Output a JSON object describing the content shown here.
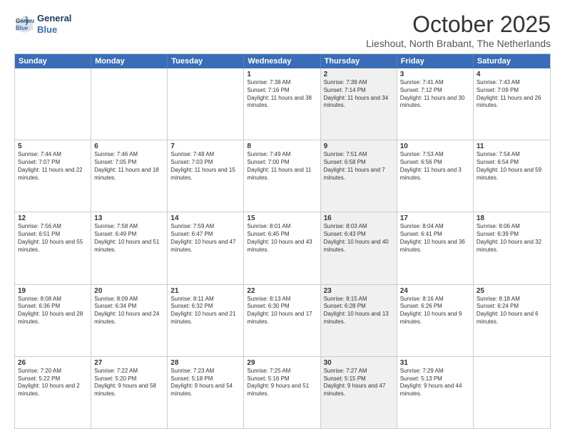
{
  "logo": {
    "line1": "General",
    "line2": "Blue"
  },
  "title": "October 2025",
  "subtitle": "Lieshout, North Brabant, The Netherlands",
  "header_days": [
    "Sunday",
    "Monday",
    "Tuesday",
    "Wednesday",
    "Thursday",
    "Friday",
    "Saturday"
  ],
  "rows": [
    [
      {
        "day": "",
        "text": "",
        "shaded": false,
        "empty": true
      },
      {
        "day": "",
        "text": "",
        "shaded": false,
        "empty": true
      },
      {
        "day": "",
        "text": "",
        "shaded": false,
        "empty": true
      },
      {
        "day": "1",
        "text": "Sunrise: 7:38 AM\nSunset: 7:16 PM\nDaylight: 11 hours and 38 minutes.",
        "shaded": false
      },
      {
        "day": "2",
        "text": "Sunrise: 7:39 AM\nSunset: 7:14 PM\nDaylight: 11 hours and 34 minutes.",
        "shaded": true
      },
      {
        "day": "3",
        "text": "Sunrise: 7:41 AM\nSunset: 7:12 PM\nDaylight: 11 hours and 30 minutes.",
        "shaded": false
      },
      {
        "day": "4",
        "text": "Sunrise: 7:43 AM\nSunset: 7:09 PM\nDaylight: 11 hours and 26 minutes.",
        "shaded": false
      }
    ],
    [
      {
        "day": "5",
        "text": "Sunrise: 7:44 AM\nSunset: 7:07 PM\nDaylight: 11 hours and 22 minutes.",
        "shaded": false
      },
      {
        "day": "6",
        "text": "Sunrise: 7:46 AM\nSunset: 7:05 PM\nDaylight: 11 hours and 18 minutes.",
        "shaded": false
      },
      {
        "day": "7",
        "text": "Sunrise: 7:48 AM\nSunset: 7:03 PM\nDaylight: 11 hours and 15 minutes.",
        "shaded": false
      },
      {
        "day": "8",
        "text": "Sunrise: 7:49 AM\nSunset: 7:00 PM\nDaylight: 11 hours and 11 minutes.",
        "shaded": false
      },
      {
        "day": "9",
        "text": "Sunrise: 7:51 AM\nSunset: 6:58 PM\nDaylight: 11 hours and 7 minutes.",
        "shaded": true
      },
      {
        "day": "10",
        "text": "Sunrise: 7:53 AM\nSunset: 6:56 PM\nDaylight: 11 hours and 3 minutes.",
        "shaded": false
      },
      {
        "day": "11",
        "text": "Sunrise: 7:54 AM\nSunset: 6:54 PM\nDaylight: 10 hours and 59 minutes.",
        "shaded": false
      }
    ],
    [
      {
        "day": "12",
        "text": "Sunrise: 7:56 AM\nSunset: 6:51 PM\nDaylight: 10 hours and 55 minutes.",
        "shaded": false
      },
      {
        "day": "13",
        "text": "Sunrise: 7:58 AM\nSunset: 6:49 PM\nDaylight: 10 hours and 51 minutes.",
        "shaded": false
      },
      {
        "day": "14",
        "text": "Sunrise: 7:59 AM\nSunset: 6:47 PM\nDaylight: 10 hours and 47 minutes.",
        "shaded": false
      },
      {
        "day": "15",
        "text": "Sunrise: 8:01 AM\nSunset: 6:45 PM\nDaylight: 10 hours and 43 minutes.",
        "shaded": false
      },
      {
        "day": "16",
        "text": "Sunrise: 8:03 AM\nSunset: 6:43 PM\nDaylight: 10 hours and 40 minutes.",
        "shaded": true
      },
      {
        "day": "17",
        "text": "Sunrise: 8:04 AM\nSunset: 6:41 PM\nDaylight: 10 hours and 36 minutes.",
        "shaded": false
      },
      {
        "day": "18",
        "text": "Sunrise: 8:06 AM\nSunset: 6:39 PM\nDaylight: 10 hours and 32 minutes.",
        "shaded": false
      }
    ],
    [
      {
        "day": "19",
        "text": "Sunrise: 8:08 AM\nSunset: 6:36 PM\nDaylight: 10 hours and 28 minutes.",
        "shaded": false
      },
      {
        "day": "20",
        "text": "Sunrise: 8:09 AM\nSunset: 6:34 PM\nDaylight: 10 hours and 24 minutes.",
        "shaded": false
      },
      {
        "day": "21",
        "text": "Sunrise: 8:11 AM\nSunset: 6:32 PM\nDaylight: 10 hours and 21 minutes.",
        "shaded": false
      },
      {
        "day": "22",
        "text": "Sunrise: 8:13 AM\nSunset: 6:30 PM\nDaylight: 10 hours and 17 minutes.",
        "shaded": false
      },
      {
        "day": "23",
        "text": "Sunrise: 8:15 AM\nSunset: 6:28 PM\nDaylight: 10 hours and 13 minutes.",
        "shaded": true
      },
      {
        "day": "24",
        "text": "Sunrise: 8:16 AM\nSunset: 6:26 PM\nDaylight: 10 hours and 9 minutes.",
        "shaded": false
      },
      {
        "day": "25",
        "text": "Sunrise: 8:18 AM\nSunset: 6:24 PM\nDaylight: 10 hours and 6 minutes.",
        "shaded": false
      }
    ],
    [
      {
        "day": "26",
        "text": "Sunrise: 7:20 AM\nSunset: 5:22 PM\nDaylight: 10 hours and 2 minutes.",
        "shaded": false
      },
      {
        "day": "27",
        "text": "Sunrise: 7:22 AM\nSunset: 5:20 PM\nDaylight: 9 hours and 58 minutes.",
        "shaded": false
      },
      {
        "day": "28",
        "text": "Sunrise: 7:23 AM\nSunset: 5:18 PM\nDaylight: 9 hours and 54 minutes.",
        "shaded": false
      },
      {
        "day": "29",
        "text": "Sunrise: 7:25 AM\nSunset: 5:16 PM\nDaylight: 9 hours and 51 minutes.",
        "shaded": false
      },
      {
        "day": "30",
        "text": "Sunrise: 7:27 AM\nSunset: 5:15 PM\nDaylight: 9 hours and 47 minutes.",
        "shaded": true
      },
      {
        "day": "31",
        "text": "Sunrise: 7:29 AM\nSunset: 5:13 PM\nDaylight: 9 hours and 44 minutes.",
        "shaded": false
      },
      {
        "day": "",
        "text": "",
        "shaded": false,
        "empty": true
      }
    ]
  ]
}
